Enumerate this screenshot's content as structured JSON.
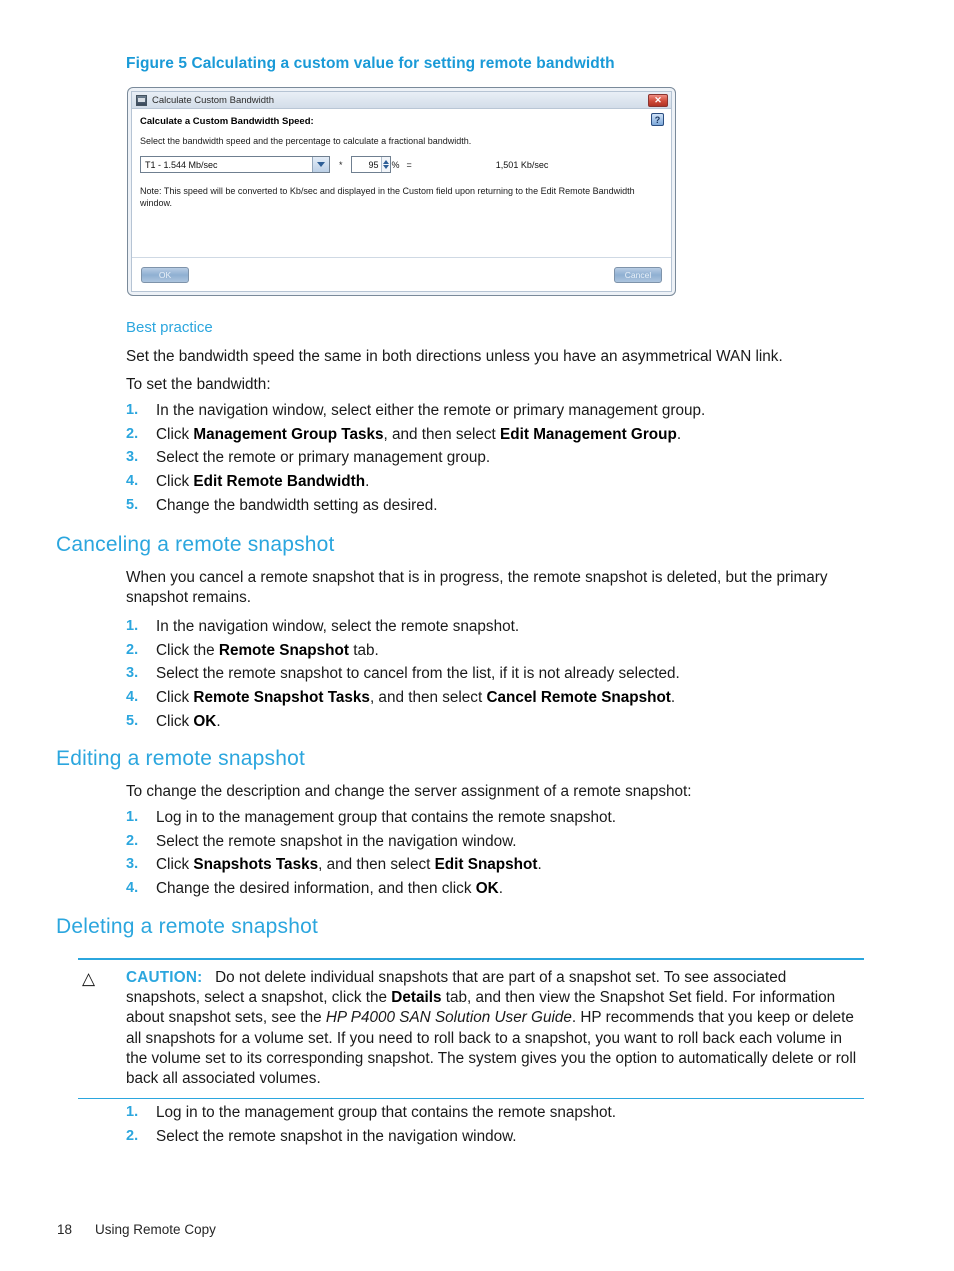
{
  "figure": {
    "caption": "Figure 5 Calculating a custom value for setting remote bandwidth"
  },
  "dialog": {
    "title": "Calculate Custom Bandwidth",
    "close_label": "✕",
    "help_label": "?",
    "heading": "Calculate a Custom Bandwidth Speed:",
    "description": "Select the bandwidth speed and the percentage to calculate a fractional bandwidth.",
    "speed_select": "T1 - 1.544 Mb/sec",
    "multiply_sign": "*",
    "percent_value": "95",
    "percent_sign": "%",
    "equals_sign": "=",
    "result": "1,501 Kb/sec",
    "note": "Note: This speed will be converted to Kb/sec and displayed in the Custom field upon returning to the Edit Remote Bandwidth window.",
    "ok_label": "OK",
    "cancel_label": "Cancel"
  },
  "best_practice": {
    "heading": "Best practice",
    "paragraph": "Set the bandwidth speed the same in both directions unless you have an asymmetrical WAN link.",
    "intro": "To set the bandwidth:",
    "steps": [
      {
        "num": "1.",
        "text": "In the navigation window, select either the remote or primary management group."
      },
      {
        "num": "2.",
        "pre": "Click ",
        "bold1": "Management Group Tasks",
        "mid": ", and then select ",
        "bold2": "Edit Management Group",
        "post": "."
      },
      {
        "num": "3.",
        "text": "Select the remote or primary management group."
      },
      {
        "num": "4.",
        "pre": "Click ",
        "bold1": "Edit Remote Bandwidth",
        "post": "."
      },
      {
        "num": "5.",
        "text": "Change the bandwidth setting as desired."
      }
    ]
  },
  "canceling": {
    "heading": "Canceling a remote snapshot",
    "paragraph": "When you cancel a remote snapshot that is in progress, the remote snapshot is deleted, but the primary snapshot remains.",
    "steps": [
      {
        "num": "1.",
        "text": "In the navigation window, select the remote snapshot."
      },
      {
        "num": "2.",
        "pre": "Click the ",
        "bold1": "Remote Snapshot",
        "post": " tab."
      },
      {
        "num": "3.",
        "text": "Select the remote snapshot to cancel from the list, if it is not already selected."
      },
      {
        "num": "4.",
        "pre": "Click ",
        "bold1": "Remote Snapshot Tasks",
        "mid": ", and then select ",
        "bold2": "Cancel Remote Snapshot",
        "post": "."
      },
      {
        "num": "5.",
        "pre": "Click ",
        "bold1": "OK",
        "post": "."
      }
    ]
  },
  "editing": {
    "heading": "Editing a remote snapshot",
    "paragraph": "To change the description and change the server assignment of a remote snapshot:",
    "steps": [
      {
        "num": "1.",
        "text": "Log in to the management group that contains the remote snapshot."
      },
      {
        "num": "2.",
        "text": "Select the remote snapshot in the navigation window."
      },
      {
        "num": "3.",
        "pre": "Click ",
        "bold1": "Snapshots Tasks",
        "mid": ", and then select ",
        "bold2": "Edit Snapshot",
        "post": "."
      },
      {
        "num": "4.",
        "pre": "Change the desired information, and then click ",
        "bold1": "OK",
        "post": "."
      }
    ]
  },
  "deleting": {
    "heading": "Deleting a remote snapshot",
    "caution": {
      "icon": "△",
      "label": "CAUTION:",
      "part1": "Do not delete individual snapshots that are part of a snapshot set. To see associated snapshots, select a snapshot, click the ",
      "bold1": "Details",
      "part2": " tab, and then view the Snapshot Set field. For information about snapshot sets, see the ",
      "italic1": "HP P4000 SAN Solution User Guide",
      "part3": ". HP recommends that you keep or delete all snapshots for a volume set. If you need to roll back to a snapshot, you want to roll back each volume in the volume set to its corresponding snapshot. The system gives you the option to automatically delete or roll back all associated volumes."
    },
    "steps": [
      {
        "num": "1.",
        "text": "Log in to the management group that contains the remote snapshot."
      },
      {
        "num": "2.",
        "text": "Select the remote snapshot in the navigation window."
      }
    ]
  },
  "footer": {
    "page_number": "18",
    "chapter": "Using Remote Copy"
  },
  "colors": {
    "accent": "#2ba6de",
    "caption": "#1a9ad7",
    "text": "#1a1a1a"
  }
}
